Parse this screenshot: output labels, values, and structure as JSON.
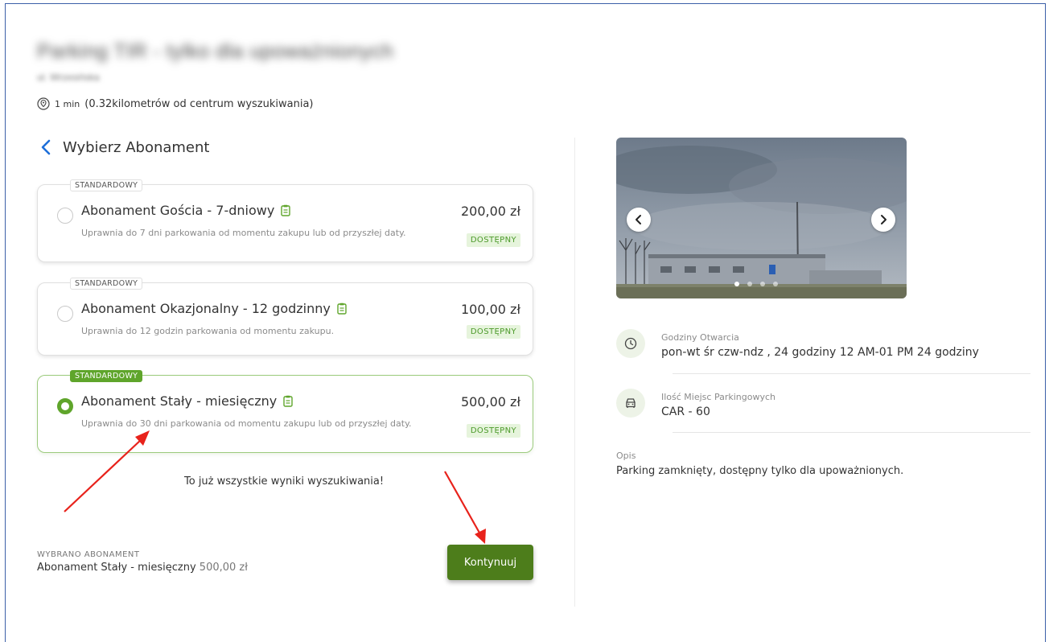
{
  "header": {
    "title": "Parking TIR - tylko dla upoważnionych",
    "subtitle": "ul. Wrzesińska",
    "distance_time": "1 min",
    "distance_text": "(0.32kilometrów od centrum wyszukiwania)"
  },
  "plans": {
    "heading": "Wybierz Abonament",
    "items": [
      {
        "tag": "STANDARDOWY",
        "title": "Abonament Gościa - 7-dniowy",
        "description": "Uprawnia do 7 dni parkowania od momentu zakupu lub od przyszłej daty.",
        "price": "200,00 zł",
        "status": "DOSTĘPNY",
        "selected": false
      },
      {
        "tag": "STANDARDOWY",
        "title": "Abonament Okazjonalny - 12 godzinny",
        "description": "Uprawnia do 12 godzin parkowania od momentu zakupu.",
        "price": "100,00 zł",
        "status": "DOSTĘPNY",
        "selected": false
      },
      {
        "tag": "STANDARDOWY",
        "title": "Abonament Stały - miesięczny",
        "description": "Uprawnia do 30 dni parkowania od momentu zakupu lub od przyszłej daty.",
        "price": "500,00 zł",
        "status": "DOSTĘPNY",
        "selected": true
      }
    ],
    "end_message": "To już wszystkie wyniki wyszukiwania!"
  },
  "selection": {
    "label": "WYBRANO ABONAMENT",
    "name": "Abonament Stały - miesięczny",
    "price": "500,00 zł"
  },
  "continue_label": "Kontynuuj",
  "gallery": {
    "slide_count": 4,
    "active_slide": 1
  },
  "details": {
    "hours_label": "Godziny Otwarcia",
    "hours_value": "pon-wt śr czw-ndz , 24 godziny 12 AM-01 PM 24 godziny",
    "spaces_label": "Ilość Miejsc Parkingowych",
    "spaces_value": "CAR - 60",
    "description_label": "Opis",
    "description_value": "Parking zamknięty, dostępny tylko dla upoważnionych."
  },
  "colors": {
    "accent": "#5fa52b",
    "button": "#4d7d1b",
    "badge_bg": "#e6f4dc",
    "back_chevron": "#1e6fd9",
    "frame_border": "#3c5fa8",
    "annotation_arrow": "#e8221b"
  }
}
